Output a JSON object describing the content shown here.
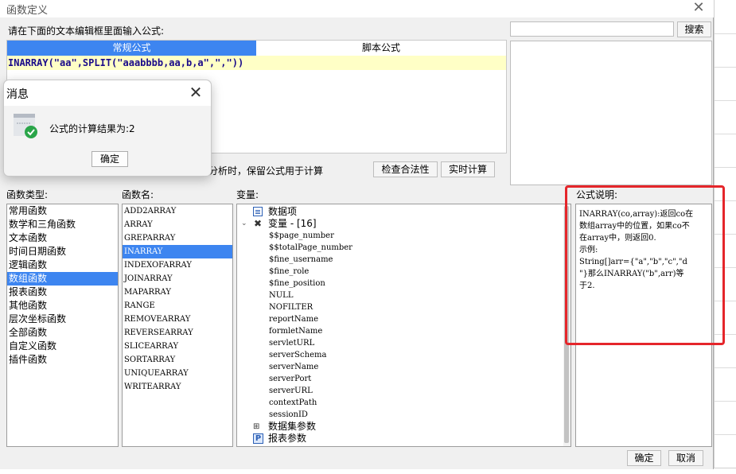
{
  "dialog": {
    "title": "函数定义",
    "close_icon": "close-icon",
    "prompt": "请在下面的文本编辑框里面输入公式:",
    "tabs": [
      "常规公式",
      "脚本公式"
    ],
    "formula": "INARRAY(\"aa\",SPLIT(\"aaabbbb,aa,b,a\",\",\"))",
    "preserve_text": "/分析时，保留公式用于计算",
    "check_button": "检查合法性",
    "live_button": "实时计算",
    "search_button": "搜索",
    "search_value": "",
    "ok_button": "确定",
    "cancel_button": "取消"
  },
  "categories": {
    "label": "函数类型:",
    "items": [
      "常用函数",
      "数学和三角函数",
      "文本函数",
      "时间日期函数",
      "逻辑函数",
      "数组函数",
      "报表函数",
      "其他函数",
      "层次坐标函数",
      "全部函数",
      "自定义函数",
      "插件函数"
    ],
    "selected": "数组函数"
  },
  "functions": {
    "label": "函数名:",
    "items": [
      "ADD2ARRAY",
      "ARRAY",
      "GREPARRAY",
      "INARRAY",
      "INDEXOFARRAY",
      "JOINARRAY",
      "MAPARRAY",
      "RANGE",
      "REMOVEARRAY",
      "REVERSEARRAY",
      "SLICEARRAY",
      "SORTARRAY",
      "UNIQUEARRAY",
      "WRITEARRAY"
    ],
    "selected": "INARRAY"
  },
  "variables": {
    "label": "变量:",
    "data_item": "数据项",
    "var_group": "变量 - [16]",
    "vars": [
      "$$page_number",
      "$$totalPage_number",
      "$fine_username",
      "$fine_role",
      "$fine_position",
      "NULL",
      "NOFILTER",
      "reportName",
      "formletName",
      "servletURL",
      "serverSchema",
      "serverName",
      "serverPort",
      "serverURL",
      "contextPath",
      "sessionID"
    ],
    "dataset_params": "数据集参数",
    "report_params": "报表参数"
  },
  "description": {
    "label": "公式说明:",
    "lines": [
      "INARRAY(co,array):返回co在",
      "数组array中的位置，如果co不",
      "在array中，则返回0.",
      "示例:",
      "String[]arr={\"a\",\"b\",\"c\",\"d",
      "\"}那么INARRAY(\"b\",arr)等",
      "于2."
    ]
  },
  "message": {
    "title": "消息",
    "text": "公式的计算结果为:2",
    "ok": "确定",
    "icon": "success-check-icon"
  },
  "colors": {
    "selection": "#3d85f0",
    "highlight_frame": "#e5262b",
    "formula_bg": "#ffffc6"
  }
}
